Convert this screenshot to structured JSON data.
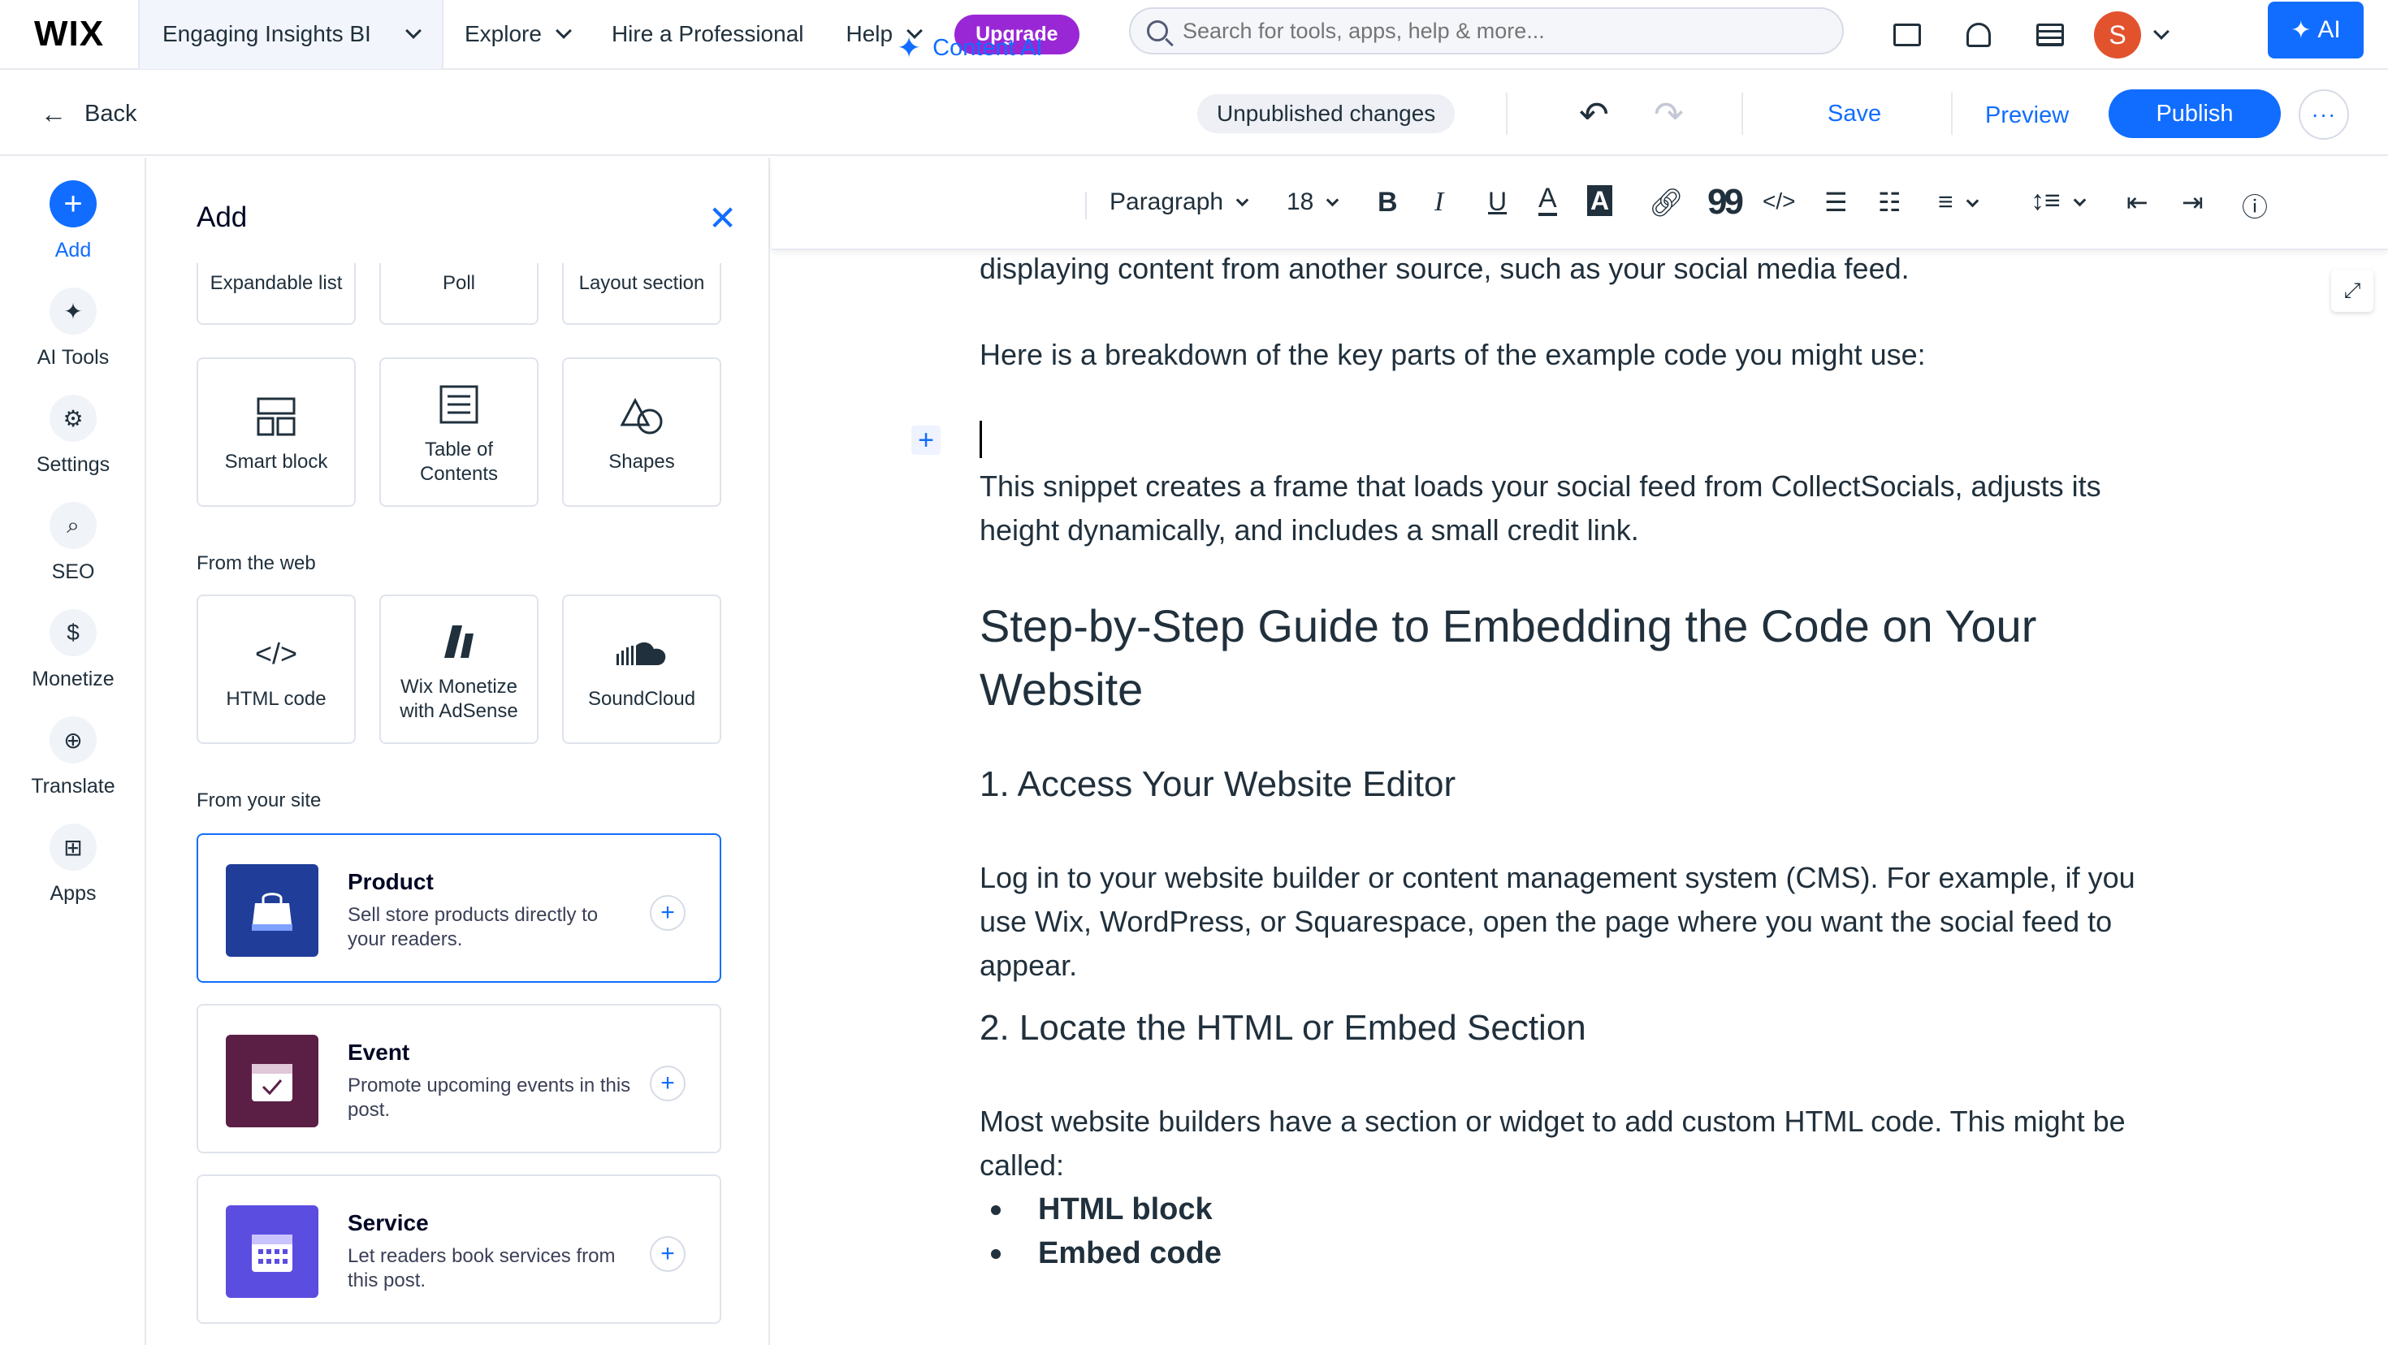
{
  "topbar": {
    "logo": "WIX",
    "site_name": "Engaging Insights BI",
    "nav": [
      "Explore",
      "Hire a Professional",
      "Help"
    ],
    "upgrade_label": "Upgrade",
    "search_placeholder": "Search for tools, apps, help & more...",
    "avatar_initial": "S",
    "ai_label": "AI"
  },
  "subbar": {
    "back_label": "Back",
    "status": "Unpublished changes",
    "save_label": "Save",
    "preview_label": "Preview",
    "publish_label": "Publish",
    "more_label": "···"
  },
  "rail": {
    "items": [
      {
        "label": "Add",
        "icon": "plus-icon"
      },
      {
        "label": "AI Tools",
        "icon": "sparkle-icon"
      },
      {
        "label": "Settings",
        "icon": "gear-icon"
      },
      {
        "label": "SEO",
        "icon": "search-icon"
      },
      {
        "label": "Monetize",
        "icon": "dollar-icon"
      },
      {
        "label": "Translate",
        "icon": "globe-icon"
      },
      {
        "label": "Apps",
        "icon": "apps-icon"
      }
    ]
  },
  "panel": {
    "title": "Add",
    "partial_tiles": [
      "Expandable list",
      "Poll",
      "Layout section"
    ],
    "tiles": [
      {
        "label": "Smart block",
        "icon": "smart-block-icon"
      },
      {
        "label": "Table of Contents",
        "icon": "table-of-contents-icon"
      },
      {
        "label": "Shapes",
        "icon": "shapes-icon"
      }
    ],
    "from_web_label": "From the web",
    "web_tiles": [
      {
        "label": "HTML code",
        "glyph": "</>",
        "icon": "html-code-icon"
      },
      {
        "label": "Wix Monetize with AdSense",
        "icon": "adsense-icon"
      },
      {
        "label": "SoundCloud",
        "icon": "soundcloud-icon"
      }
    ],
    "from_site_label": "From your site",
    "cards": [
      {
        "title": "Product",
        "desc": "Sell store products directly to your readers.",
        "color": "#1f3d99",
        "icon": "shopping-bag-icon"
      },
      {
        "title": "Event",
        "desc": "Promote upcoming events in this post.",
        "color": "#5b1f45",
        "icon": "calendar-check-icon"
      },
      {
        "title": "Service",
        "desc": "Let readers book services from this post.",
        "color": "#5b4de0",
        "icon": "calendar-grid-icon"
      }
    ],
    "add_glyph": "+"
  },
  "toolbar": {
    "content_ai_label": "Content AI",
    "paragraph_label": "Paragraph",
    "font_size": "18",
    "bold": "B",
    "italic": "I",
    "underline": "U",
    "text_color": "A",
    "highlight": "A",
    "quote": "99",
    "code": "</>"
  },
  "document": {
    "p1": "displaying content from another source, such as your social media feed.",
    "p2": "Here is a breakdown of the key parts of the example code you might use:",
    "p3": "This snippet creates a frame that loads your social feed from CollectSocials, adjusts its height dynamically, and includes a small credit link.",
    "h2": "Step-by-Step Guide to Embedding the Code on Your Website",
    "h3_1": "1. Access Your Website Editor",
    "p4": "Log in to your website builder or content management system (CMS). For example, if you use Wix, WordPress, or Squarespace, open the page where you want the social feed to appear.",
    "h3_2": "2. Locate the HTML or Embed Section",
    "p5": "Most website builders have a section or widget to add custom HTML code. This might be called:",
    "bullets": [
      "HTML block",
      "Embed code"
    ]
  },
  "colors": {
    "accent": "#116dff",
    "upgrade": "#9a27d5",
    "avatar": "#e2532d"
  }
}
